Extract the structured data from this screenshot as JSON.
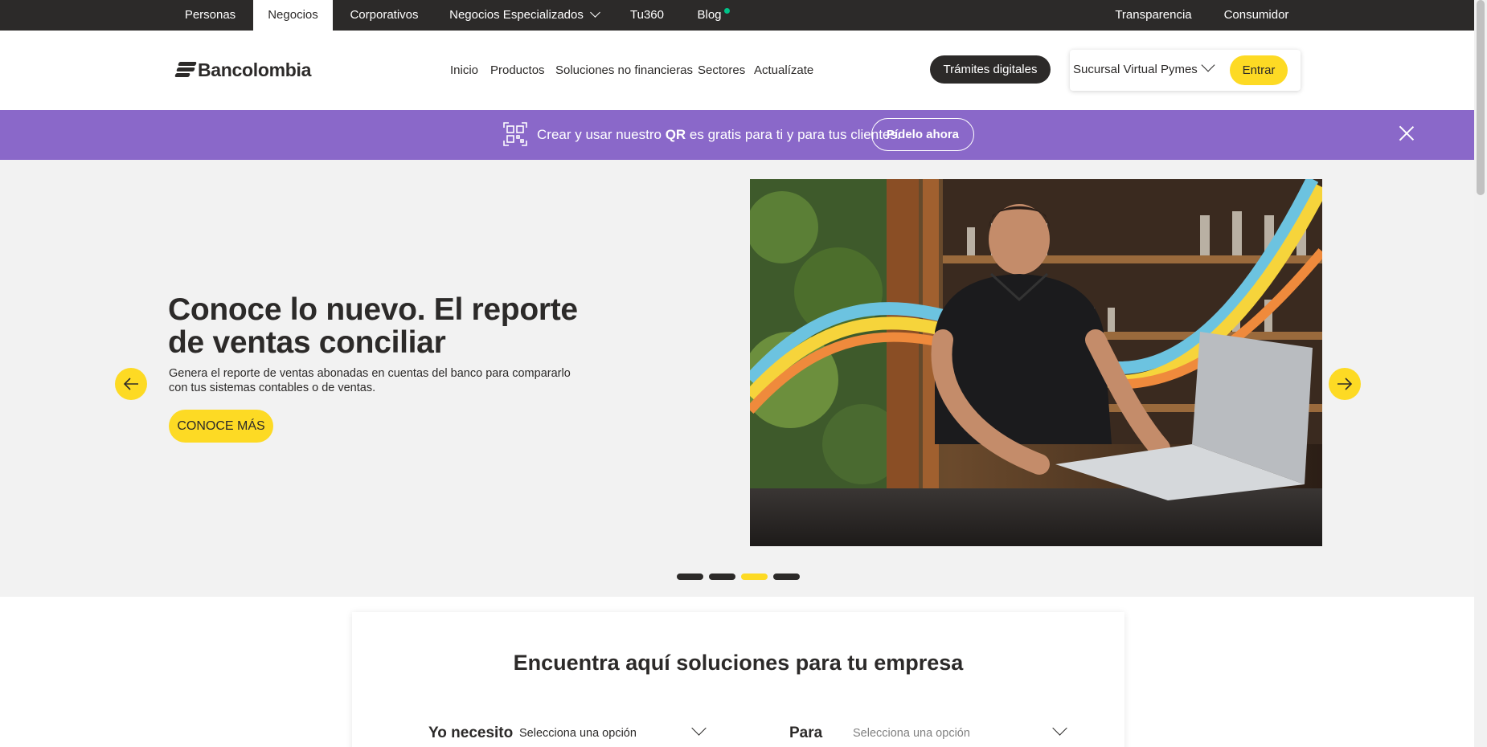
{
  "topbar": {
    "tabs": [
      {
        "label": "Personas"
      },
      {
        "label": "Negocios"
      },
      {
        "label": "Corporativos"
      },
      {
        "label": "Negocios Especializados"
      },
      {
        "label": "Tu360"
      },
      {
        "label": "Blog"
      },
      {
        "label": "Transparencia"
      },
      {
        "label": "Consumidor"
      }
    ],
    "active_tab": "Negocios",
    "blog_dot_color": "#00c389"
  },
  "header": {
    "logo_text": "Bancolombia",
    "nav": [
      "Inicio",
      "Productos",
      "Soluciones no financieras",
      "Sectores",
      "Actualízate"
    ],
    "tramites_label": "Trámites digitales",
    "sucursal_label": "Sucursal Virtual Pymes",
    "entrar_label": "Entrar"
  },
  "banner": {
    "text_before": "Crear y usar nuestro ",
    "text_bold": "QR",
    "text_after": " es gratis para ti y para tus clientes.",
    "button_label": "Pídelo ahora",
    "icon": "qr-code-icon",
    "color": "#8a68c9"
  },
  "hero": {
    "title": "Conoce lo nuevo. El reporte de ventas conciliar",
    "description": " Genera el reporte de ventas abonadas en cuentas del banco para compararlo con tus sistemas contables o de ventas.",
    "button_label": "CONOCE MÁS",
    "slides_total": 4,
    "active_slide": 3,
    "accent_color": "#fdda24"
  },
  "finder": {
    "title": "Encuentra aquí soluciones para tu empresa",
    "need_label": "Yo necesito",
    "need_value": "Selecciona una opción",
    "for_label": "Para",
    "for_placeholder": "Selecciona una opción"
  }
}
